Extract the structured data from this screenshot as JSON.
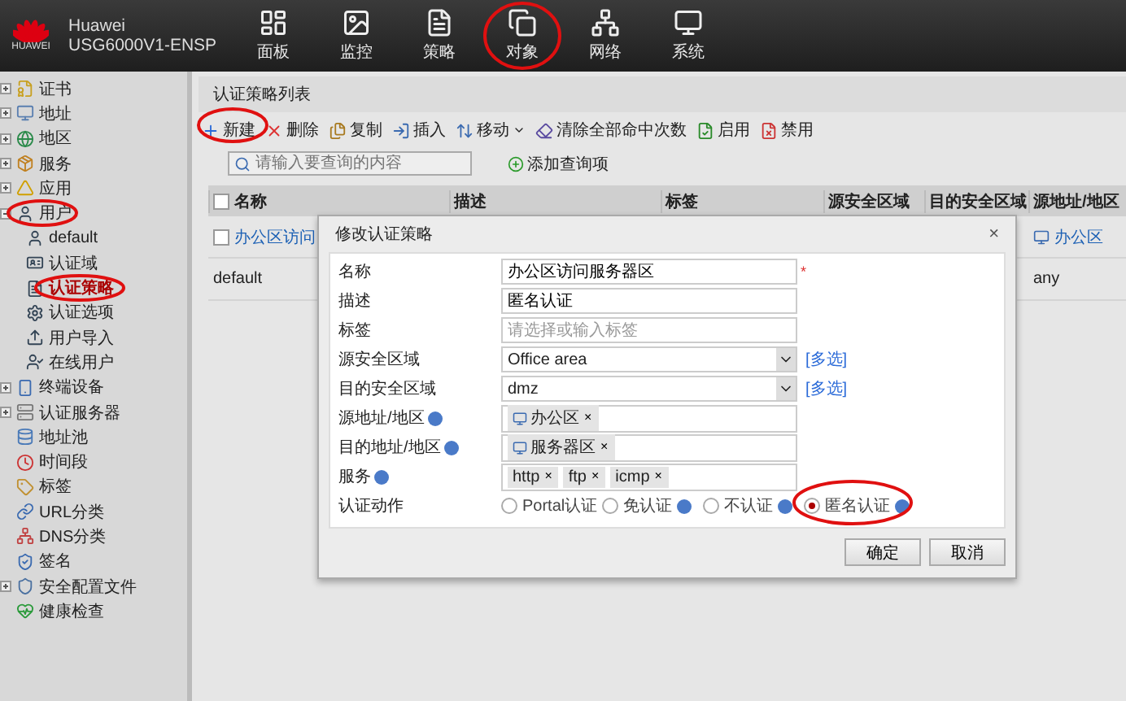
{
  "header": {
    "logo": "HUAWEI",
    "product": "Huawei",
    "model": "USG6000V1-ENSP"
  },
  "nav": [
    {
      "label": "面板"
    },
    {
      "label": "监控"
    },
    {
      "label": "策略"
    },
    {
      "label": "对象"
    },
    {
      "label": "网络"
    },
    {
      "label": "系统"
    }
  ],
  "sidebar": {
    "items": [
      {
        "label": "证书",
        "expandable": true,
        "expanded": false
      },
      {
        "label": "地址",
        "expandable": true,
        "expanded": false
      },
      {
        "label": "地区",
        "expandable": true,
        "expanded": false
      },
      {
        "label": "服务",
        "expandable": true,
        "expanded": false
      },
      {
        "label": "应用",
        "expandable": true,
        "expanded": false
      },
      {
        "label": "用户",
        "expandable": true,
        "expanded": true,
        "children": [
          {
            "label": "default",
            "selected": false
          },
          {
            "label": "认证域",
            "selected": false
          },
          {
            "label": "认证策略",
            "selected": true
          },
          {
            "label": "认证选项",
            "selected": false
          },
          {
            "label": "用户导入",
            "selected": false
          },
          {
            "label": "在线用户",
            "selected": false
          }
        ]
      },
      {
        "label": "终端设备",
        "expandable": true,
        "expanded": false
      },
      {
        "label": "认证服务器",
        "expandable": true,
        "expanded": false
      },
      {
        "label": "地址池",
        "expandable": false
      },
      {
        "label": "时间段",
        "expandable": false
      },
      {
        "label": "标签",
        "expandable": false
      },
      {
        "label": "URL分类",
        "expandable": false
      },
      {
        "label": "DNS分类",
        "expandable": false
      },
      {
        "label": "签名",
        "expandable": false
      },
      {
        "label": "安全配置文件",
        "expandable": true,
        "expanded": false
      },
      {
        "label": "健康检查",
        "expandable": false
      }
    ]
  },
  "panel": {
    "title": "认证策略列表",
    "toolbar": [
      {
        "label": "新建",
        "dropdown": false
      },
      {
        "label": "删除",
        "dropdown": false
      },
      {
        "label": "复制",
        "dropdown": false
      },
      {
        "label": "插入",
        "dropdown": false
      },
      {
        "label": "移动",
        "dropdown": true
      },
      {
        "label": "清除全部命中次数",
        "dropdown": false
      },
      {
        "label": "启用",
        "dropdown": false
      },
      {
        "label": "禁用",
        "dropdown": false
      }
    ],
    "search": {
      "placeholder": "请输入要查询的内容"
    },
    "add_query": "添加查询项",
    "table": {
      "select_all_checked": false,
      "columns": [
        "名称",
        "描述",
        "标签",
        "源安全区域",
        "目的安全区域",
        "源地址/地区"
      ],
      "rows": [
        {
          "checked": false,
          "cells": [
            "办公区访问",
            "",
            "",
            "",
            "",
            "办公区"
          ]
        },
        {
          "cells": [
            "default",
            "",
            "",
            "",
            "",
            "any"
          ]
        }
      ]
    }
  },
  "dialog": {
    "title": "修改认证策略",
    "close": "×",
    "fields": [
      {
        "kind": "text",
        "label": "名称",
        "value": "办公区访问服务器区",
        "required": "*"
      },
      {
        "kind": "text",
        "label": "描述",
        "value": "匿名认证"
      },
      {
        "kind": "text",
        "label": "标签",
        "placeholder": "请选择或输入标签"
      },
      {
        "kind": "select",
        "label": "源安全区域",
        "value": "Office area",
        "link": "[多选]"
      },
      {
        "kind": "select",
        "label": "目的安全区域",
        "value": "dmz",
        "link": "[多选]"
      },
      {
        "kind": "tags",
        "label": "源地址/地区",
        "help": true,
        "tags": [
          {
            "label": "办公区",
            "kind": "address",
            "remove": "×"
          }
        ]
      },
      {
        "kind": "tags",
        "label": "目的地址/地区",
        "help": true,
        "tags": [
          {
            "label": "服务器区",
            "kind": "address",
            "remove": "×"
          }
        ]
      },
      {
        "kind": "tags",
        "label": "服务",
        "help": true,
        "tags": [
          {
            "label": "http",
            "kind": "service",
            "remove": "×"
          },
          {
            "label": "ftp",
            "kind": "service",
            "remove": "×"
          },
          {
            "label": "icmp",
            "kind": "service",
            "remove": "×"
          }
        ]
      },
      {
        "kind": "radio",
        "label": "认证动作",
        "help": false,
        "options": [
          {
            "label": "Portal认证",
            "help": false,
            "selected": false
          },
          {
            "label": "免认证",
            "help": true,
            "selected": false
          },
          {
            "label": "不认证",
            "help": true,
            "selected": false
          },
          {
            "label": "匿名认证",
            "help": true,
            "selected": true
          }
        ]
      }
    ],
    "buttons": [
      "确定",
      "取消"
    ]
  }
}
